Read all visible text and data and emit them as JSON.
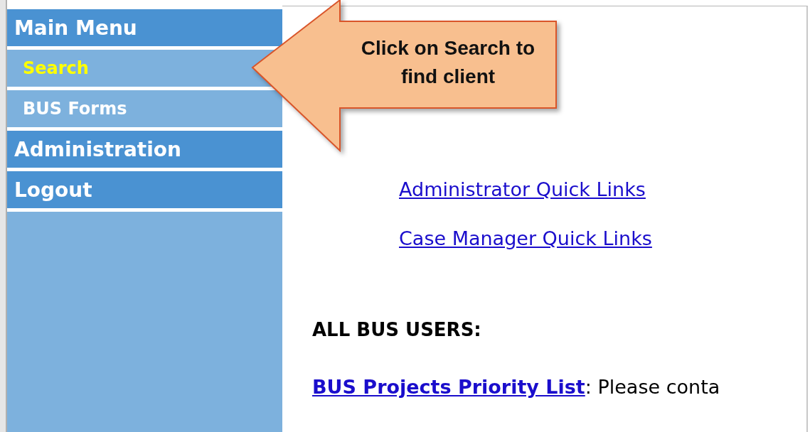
{
  "sidebar": {
    "items": [
      {
        "label": "Main Menu",
        "kind": "header",
        "selected": false
      },
      {
        "label": "Search",
        "kind": "subitem",
        "selected": true
      },
      {
        "label": "BUS Forms",
        "kind": "subitem",
        "selected": false
      },
      {
        "label": "Administration",
        "kind": "header",
        "selected": false
      },
      {
        "label": "Logout",
        "kind": "header",
        "selected": false
      }
    ]
  },
  "callout": {
    "text": "Click on Search to find client"
  },
  "content": {
    "quick_links": [
      "Administrator Quick Links",
      "Case Manager Quick Links"
    ],
    "heading": "ALL BUS USERS:",
    "notice": {
      "link": "BUS Projects Priority List",
      "text": ": Please conta"
    }
  }
}
